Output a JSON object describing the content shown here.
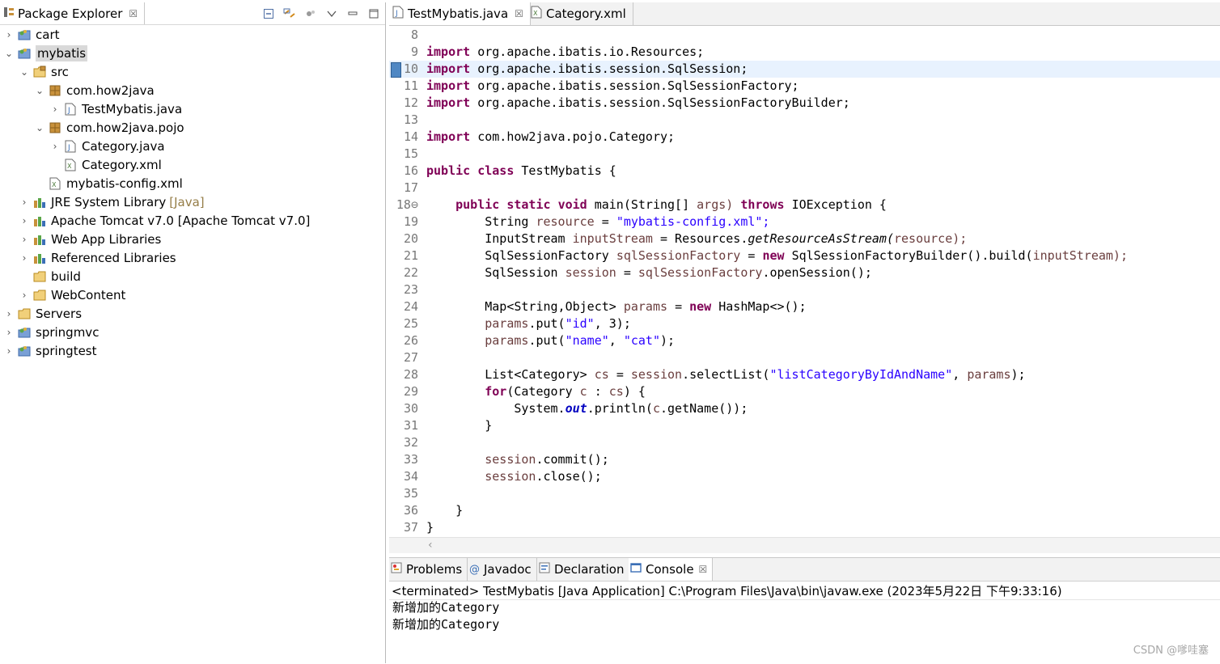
{
  "package_explorer": {
    "title": "Package Explorer",
    "close": "☒",
    "items": [
      {
        "label": "cart",
        "icon": "project-icon",
        "twisty": "›"
      },
      {
        "label": "mybatis",
        "icon": "project-icon",
        "twisty": "⌄"
      },
      {
        "label": "src",
        "icon": "source-folder-icon",
        "twisty": "⌄"
      },
      {
        "label": "com.how2java",
        "icon": "package-icon",
        "twisty": "⌄"
      },
      {
        "label": "TestMybatis.java",
        "icon": "java-file-icon",
        "twisty": "›"
      },
      {
        "label": "com.how2java.pojo",
        "icon": "package-icon",
        "twisty": "⌄"
      },
      {
        "label": "Category.java",
        "icon": "java-file-icon",
        "twisty": "›"
      },
      {
        "label": "Category.xml",
        "icon": "xml-file-icon",
        "twisty": ""
      },
      {
        "label": "mybatis-config.xml",
        "icon": "xml-file-icon",
        "twisty": ""
      },
      {
        "label": "JRE System Library",
        "decoration": "[Java]",
        "icon": "library-icon",
        "twisty": "›"
      },
      {
        "label": "Apache Tomcat v7.0 [Apache Tomcat v7.0]",
        "icon": "library-icon",
        "twisty": "›"
      },
      {
        "label": "Web App Libraries",
        "icon": "library-icon",
        "twisty": "›"
      },
      {
        "label": "Referenced Libraries",
        "icon": "library-icon",
        "twisty": "›"
      },
      {
        "label": "build",
        "icon": "folder-icon",
        "twisty": ""
      },
      {
        "label": "WebContent",
        "icon": "folder-icon",
        "twisty": "›"
      },
      {
        "label": "Servers",
        "icon": "folder-icon",
        "twisty": "›"
      },
      {
        "label": "springmvc",
        "icon": "project-icon",
        "twisty": "›"
      },
      {
        "label": "springtest",
        "icon": "project-icon",
        "twisty": "›"
      }
    ]
  },
  "editor": {
    "tabs": [
      {
        "label": "TestMybatis.java",
        "close": "☒"
      },
      {
        "label": "Category.xml"
      }
    ],
    "lines": [
      {
        "n": "8",
        "t": []
      },
      {
        "n": "9",
        "t": [
          [
            "kw",
            "import"
          ],
          [
            "",
            "org.apache.ibatis.io.Resources;"
          ]
        ]
      },
      {
        "n": "10",
        "t": [
          [
            "kw",
            "import"
          ],
          [
            "",
            "org.apache.ibatis.session.SqlSession;"
          ]
        ]
      },
      {
        "n": "11",
        "t": [
          [
            "kw",
            "import"
          ],
          [
            "",
            "org.apache.ibatis.session.SqlSessionFactory;"
          ]
        ]
      },
      {
        "n": "12",
        "t": [
          [
            "kw",
            "import"
          ],
          [
            "",
            "org.apache.ibatis.session.SqlSessionFactoryBuilder;"
          ]
        ]
      },
      {
        "n": "13",
        "t": []
      },
      {
        "n": "14",
        "t": [
          [
            "kw",
            "import"
          ],
          [
            "",
            "com.how2java.pojo.Category;"
          ]
        ]
      },
      {
        "n": "15",
        "t": []
      },
      {
        "n": "16",
        "t": [
          [
            "kw",
            "public"
          ],
          [
            "kw",
            "class"
          ],
          [
            "",
            "TestMybatis {"
          ]
        ]
      },
      {
        "n": "17",
        "t": []
      },
      {
        "n": "18⊖",
        "t": [
          [
            "kw",
            "public"
          ],
          [
            "kw",
            "static"
          ],
          [
            "kw",
            "void"
          ],
          [
            "",
            "main(String[]"
          ],
          [
            "fld",
            "args)"
          ],
          [
            "kw",
            "throws"
          ],
          [
            "",
            "IOException {"
          ]
        ]
      },
      {
        "n": "19",
        "t": [
          [
            "",
            "String"
          ],
          [
            "fld",
            "resource"
          ],
          [
            "",
            "="
          ],
          [
            "str",
            "\"mybatis-config.xml\";"
          ]
        ]
      },
      {
        "n": "20",
        "t": [
          [
            "",
            "InputStream"
          ],
          [
            "fld",
            "inputStream"
          ],
          [
            "",
            "= Resources."
          ],
          [
            "it",
            "getResourceAsStream("
          ],
          [
            "fld",
            "resource);"
          ]
        ]
      },
      {
        "n": "21",
        "t": [
          [
            "",
            "SqlSessionFactory"
          ],
          [
            "fld",
            "sqlSessionFactory"
          ],
          [
            "",
            "="
          ],
          [
            "kw",
            "new"
          ],
          [
            "",
            "SqlSessionFactoryBuilder().build("
          ],
          [
            "fld",
            "inputStream);"
          ]
        ]
      },
      {
        "n": "22",
        "t": [
          [
            "",
            "SqlSession"
          ],
          [
            "fld",
            "session"
          ],
          [
            "",
            "="
          ],
          [
            "fld",
            "sqlSessionFactory"
          ],
          [
            "",
            ".openSession();"
          ]
        ]
      },
      {
        "n": "23",
        "t": []
      },
      {
        "n": "24",
        "t": [
          [
            "",
            "Map<String,Object>"
          ],
          [
            "fld",
            "params"
          ],
          [
            "",
            "="
          ],
          [
            "kw",
            "new"
          ],
          [
            "",
            "HashMap<>();"
          ]
        ]
      },
      {
        "n": "25",
        "t": [
          [
            "fld",
            "params"
          ],
          [
            "",
            ".put("
          ],
          [
            "str",
            "\"id\""
          ],
          [
            "",
            ", 3);"
          ]
        ]
      },
      {
        "n": "26",
        "t": [
          [
            "fld",
            "params"
          ],
          [
            "",
            ".put("
          ],
          [
            "str",
            "\"name\""
          ],
          [
            "",
            ", "
          ],
          [
            "str",
            "\"cat\""
          ],
          [
            "",
            ");"
          ]
        ]
      },
      {
        "n": "27",
        "t": []
      },
      {
        "n": "28",
        "t": [
          [
            "",
            "List<Category>"
          ],
          [
            "fld",
            "cs"
          ],
          [
            "",
            "="
          ],
          [
            "fld",
            "session"
          ],
          [
            "",
            ".selectList("
          ],
          [
            "str",
            "\"listCategoryByIdAndName\""
          ],
          [
            "",
            ","
          ],
          [
            "fld",
            "params"
          ],
          [
            "",
            ");"
          ]
        ]
      },
      {
        "n": "29",
        "t": [
          [
            "kw",
            "for"
          ],
          [
            "",
            "(Category"
          ],
          [
            "fld",
            "c"
          ],
          [
            "",
            ":"
          ],
          [
            "fld",
            "cs"
          ],
          [
            "",
            ") {"
          ]
        ]
      },
      {
        "n": "30",
        "t": [
          [
            "",
            "System."
          ],
          [
            "st",
            "out"
          ],
          [
            "",
            ".println("
          ],
          [
            "fld",
            "c"
          ],
          [
            "",
            ".getName());"
          ]
        ]
      },
      {
        "n": "31",
        "t": [
          [
            "",
            "}"
          ]
        ]
      },
      {
        "n": "32",
        "t": []
      },
      {
        "n": "33",
        "t": [
          [
            "fld",
            "session"
          ],
          [
            "",
            ".commit();"
          ]
        ]
      },
      {
        "n": "34",
        "t": [
          [
            "fld",
            "session"
          ],
          [
            "",
            ".close();"
          ]
        ]
      },
      {
        "n": "35",
        "t": []
      },
      {
        "n": "36",
        "t": [
          [
            "",
            "}"
          ]
        ]
      },
      {
        "n": "37",
        "t": [
          [
            "",
            "}"
          ]
        ]
      }
    ],
    "scroll_left_arrow": "‹"
  },
  "bottom_panel": {
    "tabs": [
      {
        "label": "Problems",
        "icon": "problems-icon"
      },
      {
        "label": "Javadoc",
        "icon": "javadoc-icon"
      },
      {
        "label": "Declaration",
        "icon": "declaration-icon"
      },
      {
        "label": "Console",
        "icon": "console-icon",
        "close": "☒"
      }
    ],
    "console_description": "<terminated> TestMybatis [Java Application] C:\\Program Files\\Java\\bin\\javaw.exe (2023年5月22日 下午9:33:16)",
    "output": [
      "新增加的Category",
      "新增加的Category"
    ]
  },
  "watermark": "CSDN @嗲哇塞"
}
